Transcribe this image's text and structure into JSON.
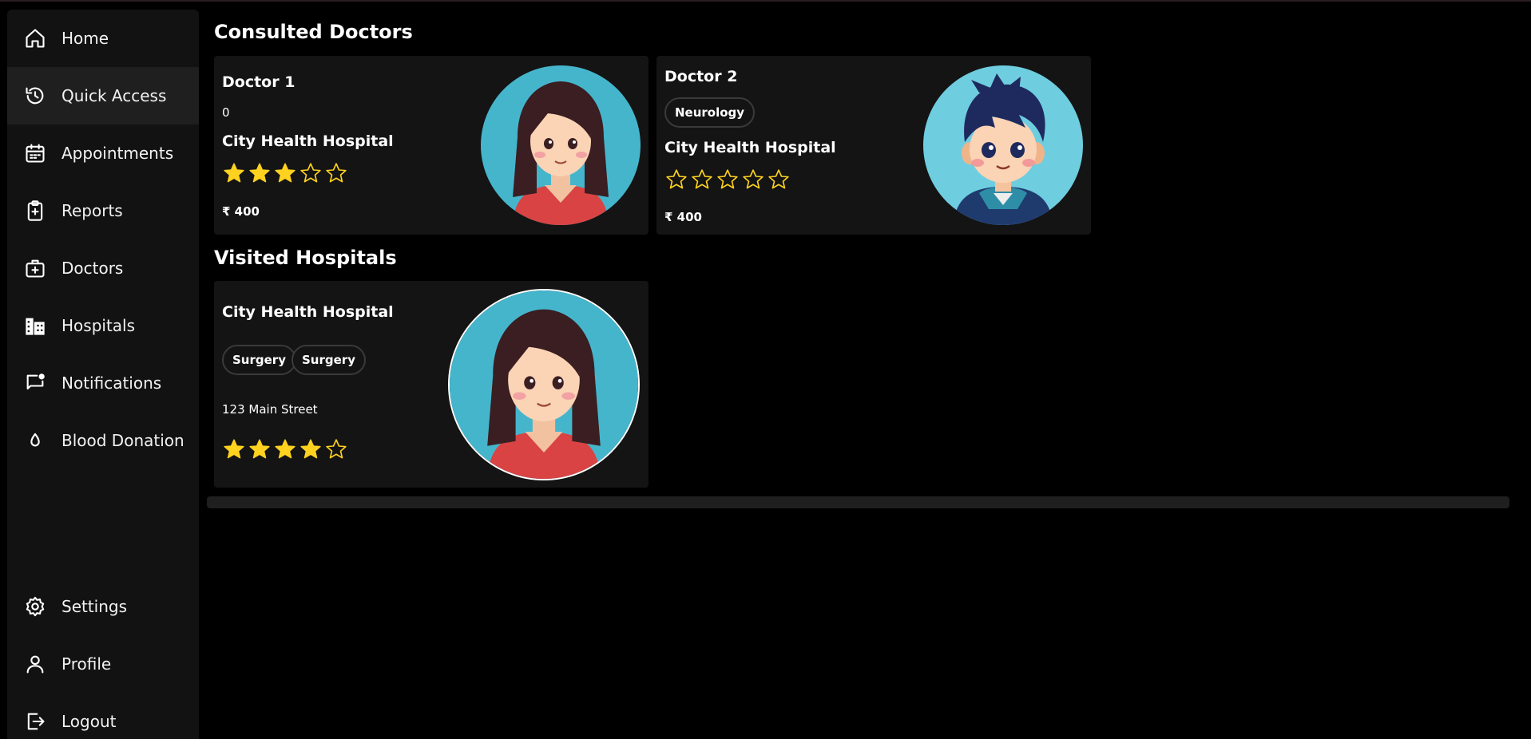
{
  "sidebar": {
    "items": [
      {
        "label": "Home",
        "icon": "home-icon"
      },
      {
        "label": "Quick Access",
        "icon": "history-icon",
        "active": true
      },
      {
        "label": "Appointments",
        "icon": "calendar-icon"
      },
      {
        "label": "Reports",
        "icon": "clipboard-icon"
      },
      {
        "label": "Doctors",
        "icon": "medical-bag-icon"
      },
      {
        "label": "Hospitals",
        "icon": "hospital-building-icon"
      },
      {
        "label": "Notifications",
        "icon": "message-notification-icon"
      },
      {
        "label": "Blood Donation",
        "icon": "blood-drop-icon"
      }
    ],
    "bottom_items": [
      {
        "label": "Settings",
        "icon": "gear-icon"
      },
      {
        "label": "Profile",
        "icon": "user-icon"
      },
      {
        "label": "Logout",
        "icon": "logout-icon"
      }
    ]
  },
  "consulted": {
    "title": "Consulted Doctors",
    "doctors": [
      {
        "name": "Doctor 1",
        "sub": "0",
        "hospital": "City Health Hospital",
        "rating": 3,
        "fee": "₹ 400",
        "avatar": "female-avatar"
      },
      {
        "name": "Doctor 2",
        "specialty": "Neurology",
        "hospital": "City Health Hospital",
        "rating": 0,
        "fee": "₹ 400",
        "avatar": "male-avatar"
      }
    ]
  },
  "visited": {
    "title": "Visited Hospitals",
    "hospitals": [
      {
        "name": "City Health Hospital",
        "tags": [
          "Surgery",
          "Surgery"
        ],
        "address": "123 Main Street",
        "rating": 4,
        "avatar": "female-avatar"
      }
    ]
  },
  "colors": {
    "star": "#FFD21F",
    "card": "#141414",
    "sidebar": "#121212",
    "avatar_bg": "#45B5CC"
  }
}
